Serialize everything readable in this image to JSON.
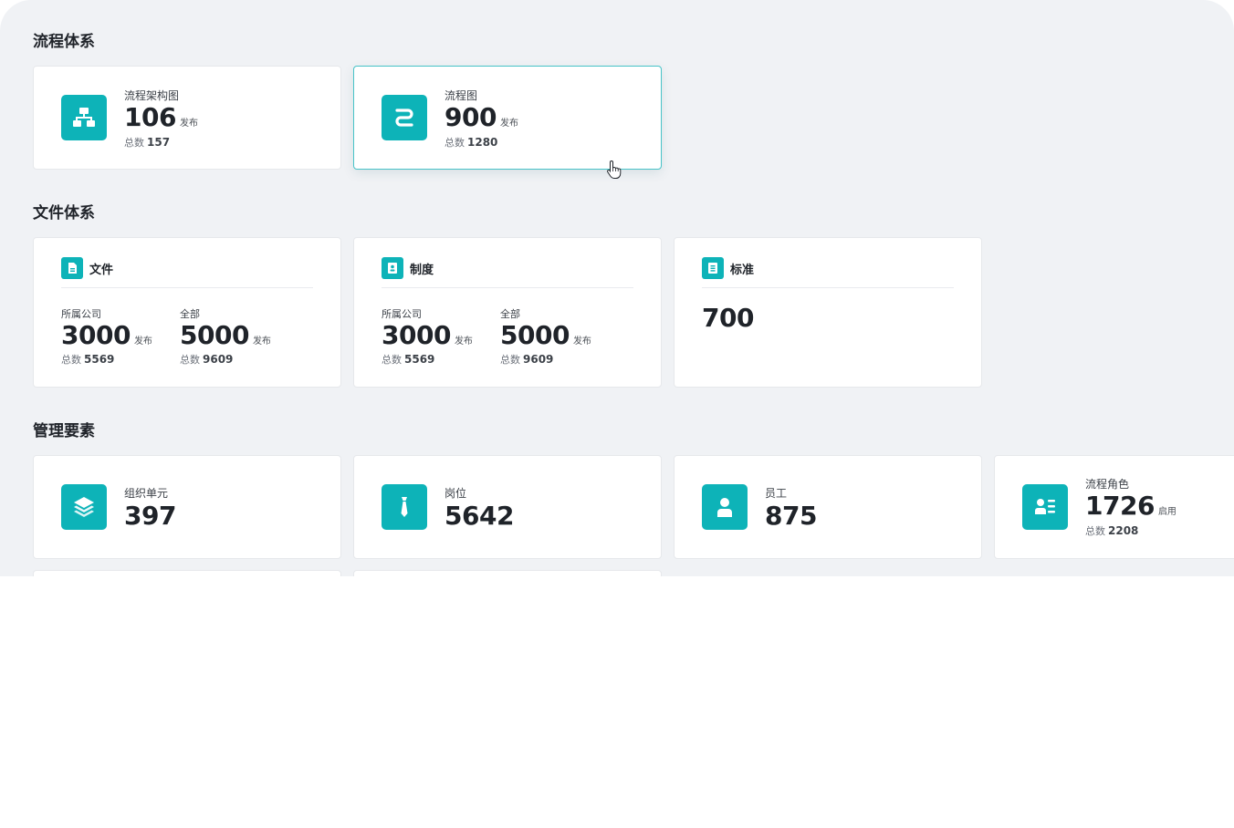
{
  "sections": {
    "process": "流程体系",
    "file": "文件体系",
    "management": "管理要素"
  },
  "process_cards": [
    {
      "label": "流程架构图",
      "value": "106",
      "unit": "发布",
      "total_label": "总数",
      "total": "157"
    },
    {
      "label": "流程图",
      "value": "900",
      "unit": "发布",
      "total_label": "总数",
      "total": "1280"
    }
  ],
  "file_cards": [
    {
      "title": "文件",
      "left": {
        "label": "所属公司",
        "value": "3000",
        "unit": "发布",
        "total_label": "总数",
        "total": "5569"
      },
      "right": {
        "label": "全部",
        "value": "5000",
        "unit": "发布",
        "total_label": "总数",
        "total": "9609"
      }
    },
    {
      "title": "制度",
      "left": {
        "label": "所属公司",
        "value": "3000",
        "unit": "发布",
        "total_label": "总数",
        "total": "5569"
      },
      "right": {
        "label": "全部",
        "value": "5000",
        "unit": "发布",
        "total_label": "总数",
        "total": "9609"
      }
    },
    {
      "title": "标准",
      "value": "700"
    }
  ],
  "management_cards": [
    {
      "label": "组织单元",
      "value": "397"
    },
    {
      "label": "岗位",
      "value": "5642"
    },
    {
      "label": "员工",
      "value": "875"
    },
    {
      "label": "流程角色",
      "value": "1726",
      "unit": "启用",
      "total_label": "总数",
      "total": "2208"
    }
  ],
  "colors": {
    "accent": "#0db3b8",
    "panel_bg": "#f0f2f5",
    "hover_border": "#47c3c8"
  },
  "icons": {
    "process_architecture": "org-chart-icon",
    "process_map": "flow-curve-icon",
    "file": "document-icon",
    "regulation": "rulebook-icon",
    "standard": "list-document-icon",
    "org_unit": "layers-icon",
    "position": "tie-icon",
    "employee": "person-icon",
    "process_role": "id-card-icon"
  }
}
